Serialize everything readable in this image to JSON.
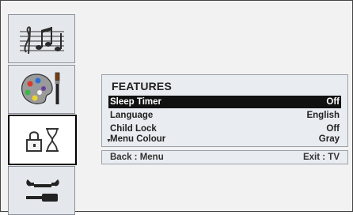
{
  "sidebar": {
    "tabs": [
      {
        "name": "sound-tab",
        "icon": "music-notes-icon"
      },
      {
        "name": "picture-tab",
        "icon": "paint-palette-icon"
      },
      {
        "name": "features-tab",
        "icon": "lock-hourglass-icon",
        "selected": true
      },
      {
        "name": "install-tab",
        "icon": "wrench-screwdriver-icon"
      }
    ]
  },
  "menu": {
    "title": "FEATURES",
    "rows": [
      {
        "label": "Sleep Timer",
        "value": "Off",
        "highlighted": true
      },
      {
        "label": "Language",
        "value": "English"
      },
      {
        "label": "Child Lock",
        "value": "Off"
      },
      {
        "label": "Menu Colour",
        "value": "Gray",
        "scroll_indicator": "▼"
      }
    ],
    "footer": {
      "left": "Back : Menu",
      "right": "Exit : TV"
    }
  },
  "colors": {
    "highlight_bg": "#111111",
    "panel_bg": "#e9ecf0"
  }
}
